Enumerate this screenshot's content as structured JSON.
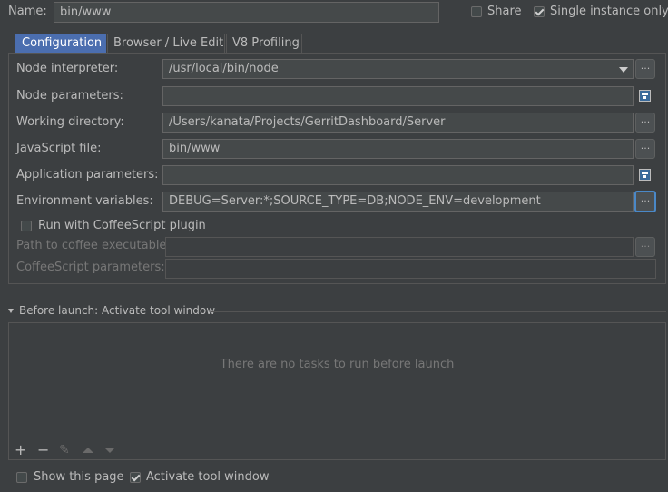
{
  "header": {
    "name_label": "Name:",
    "name_value": "bin/www",
    "share_label": "Share",
    "share_checked": false,
    "single_instance_label": "Single instance only",
    "single_instance_checked": true
  },
  "tabs": [
    {
      "label": "Configuration",
      "active": true
    },
    {
      "label": "Browser / Live Edit",
      "active": false
    },
    {
      "label": "V8 Profiling",
      "active": false
    }
  ],
  "form": {
    "node_interpreter_label": "Node interpreter:",
    "node_interpreter_value": "/usr/local/bin/node",
    "node_parameters_label": "Node parameters:",
    "node_parameters_value": "",
    "working_directory_label": "Working directory:",
    "working_directory_value": "/Users/kanata/Projects/GerritDashboard/Server",
    "javascript_file_label": "JavaScript file:",
    "javascript_file_value": "bin/www",
    "application_parameters_label": "Application parameters:",
    "application_parameters_value": "",
    "environment_variables_label": "Environment variables:",
    "environment_variables_value": "DEBUG=Server:*;SOURCE_TYPE=DB;NODE_ENV=development",
    "coffeescript_label": "Run with CoffeeScript plugin",
    "coffeescript_checked": false,
    "coffee_path_label": "Path to coffee executable:",
    "coffee_path_value": "",
    "coffee_params_label": "CoffeeScript parameters:",
    "coffee_params_value": "",
    "browse_button_label": "..."
  },
  "before_launch": {
    "title": "Before launch: Activate tool window",
    "empty_text": "There are no tasks to run before launch"
  },
  "footer": {
    "show_page_label": "Show this page",
    "show_page_checked": false,
    "activate_tool_label": "Activate tool window",
    "activate_tool_checked": true
  },
  "colors": {
    "background": "#3c3f41",
    "field": "#45494a",
    "accent": "#4b6eaf",
    "focus": "#4a88c7"
  }
}
